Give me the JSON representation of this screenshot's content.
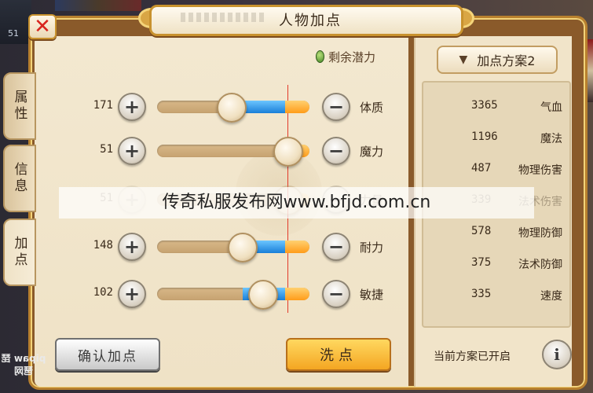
{
  "window": {
    "title": "人物加点",
    "close_label": "✕"
  },
  "side_tabs": [
    {
      "label": "属性"
    },
    {
      "label": "信息"
    },
    {
      "label": "加点"
    }
  ],
  "remaining_potential_label": "剩余潜力",
  "attributes": [
    {
      "name": "体质",
      "value": "171",
      "progress": 0.84
    },
    {
      "name": "魔力",
      "value": "51",
      "progress": 0.0
    },
    {
      "name": "力量",
      "value": "51",
      "progress": 0.0
    },
    {
      "name": "耐力",
      "value": "148",
      "progress": 0.84
    },
    {
      "name": "敏捷",
      "value": "102",
      "progress": 0.84
    }
  ],
  "plan": {
    "dropdown_label": "加点方案2",
    "chevron_icon": "chevron-down-icon"
  },
  "stats": [
    {
      "name": "气血",
      "value": "3365"
    },
    {
      "name": "魔法",
      "value": "1196"
    },
    {
      "name": "物理伤害",
      "value": "487"
    },
    {
      "name": "法术伤害",
      "value": "339"
    },
    {
      "name": "物理防御",
      "value": "578"
    },
    {
      "name": "法术防御",
      "value": "375"
    },
    {
      "name": "速度",
      "value": "335"
    }
  ],
  "buttons": {
    "wash": "洗点",
    "confirm": "确认加点",
    "plus": "+",
    "minus": "−",
    "info": "i"
  },
  "current_plan_status": "当前方案已开启",
  "watermark": "传奇私服发布网www.bfjd.com.cn",
  "hud": {
    "level_number": "51"
  },
  "logo_text": "pipaw 琵琶网",
  "colors": {
    "fill_blue": "#1a7fd8",
    "fill_orange": "#ff9c1a",
    "close_red": "#d8241e",
    "frame_gold": "#c8922e"
  }
}
